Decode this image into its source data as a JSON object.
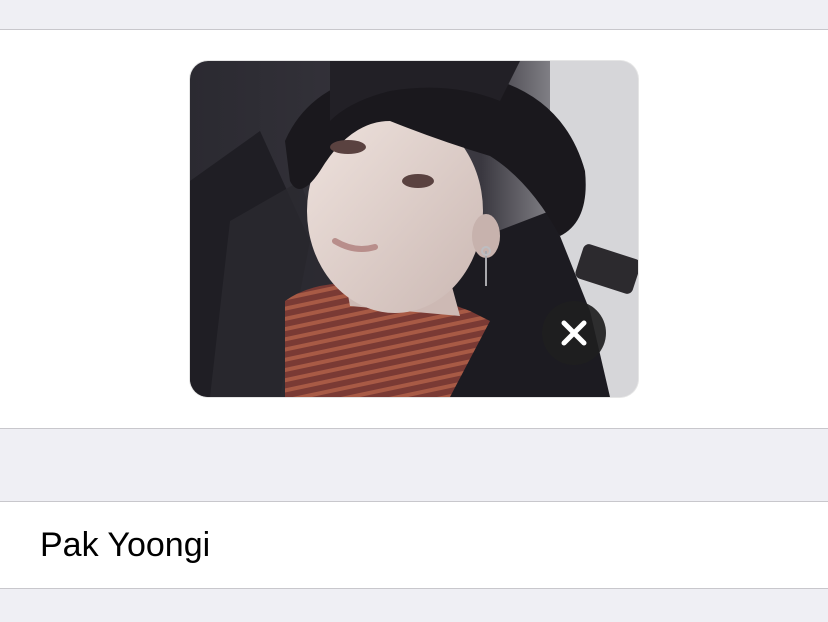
{
  "contact": {
    "name": "Pak Yoongi"
  },
  "photo": {
    "icon": "remove-photo-icon"
  },
  "colors": {
    "background": "#efeff4",
    "cell": "#ffffff",
    "separator": "#c8c7cc",
    "remove_button": "#1e1e20"
  }
}
